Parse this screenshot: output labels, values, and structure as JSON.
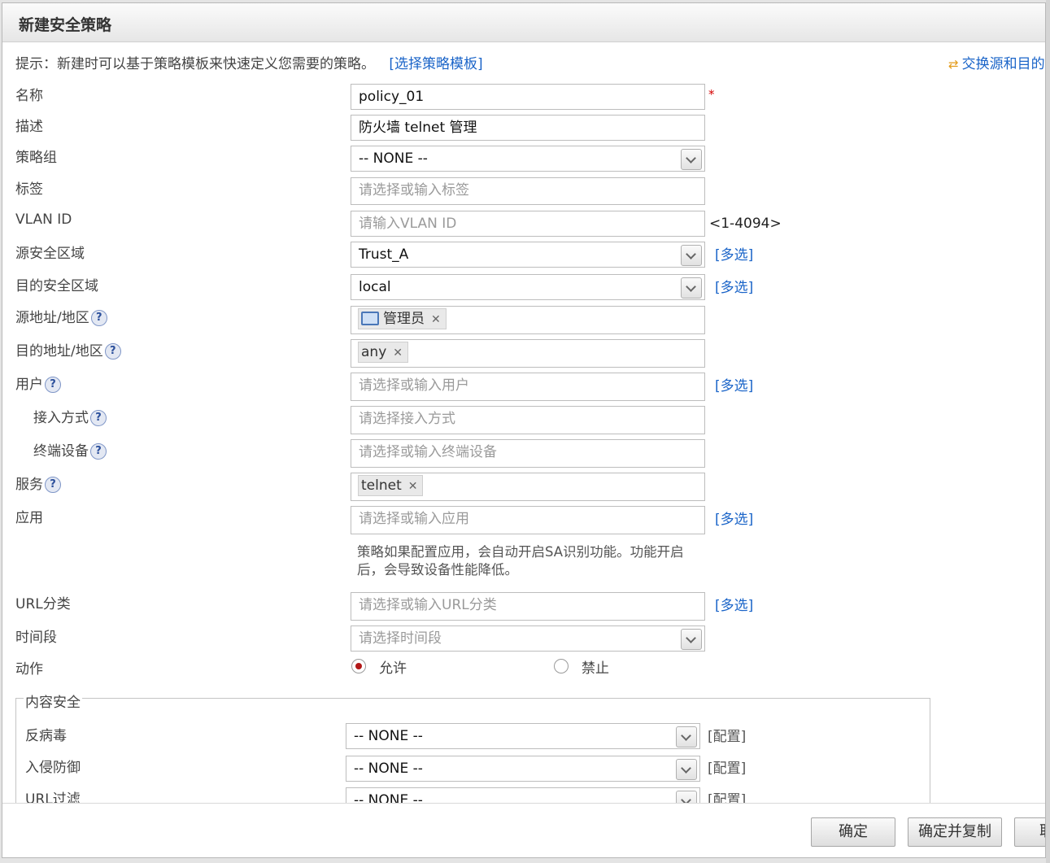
{
  "dialog": {
    "title": "新建安全策略"
  },
  "hint": {
    "text": "提示：新建时可以基于策略模板来快速定义您需要的策略。",
    "template_link": "[选择策略模板]",
    "swap_link": "交换源和目的"
  },
  "form": {
    "name": {
      "label": "名称",
      "value": "policy_01",
      "required_mark": "*"
    },
    "description": {
      "label": "描述",
      "value": "防火墙 telnet 管理"
    },
    "policy_group": {
      "label": "策略组",
      "value": "-- NONE --"
    },
    "tag": {
      "label": "标签",
      "placeholder": "请选择或输入标签"
    },
    "vlan": {
      "label": "VLAN ID",
      "placeholder": "请输入VLAN ID",
      "range": "<1-4094>"
    },
    "src_zone": {
      "label": "源安全区域",
      "value": "Trust_A",
      "multi": "[多选]"
    },
    "dst_zone": {
      "label": "目的安全区域",
      "value": "local",
      "multi": "[多选]"
    },
    "src_addr": {
      "label": "源地址/地区",
      "tag": "管理员"
    },
    "dst_addr": {
      "label": "目的地址/地区",
      "tag": "any"
    },
    "user": {
      "label": "用户",
      "placeholder": "请选择或输入用户",
      "multi": "[多选]"
    },
    "access": {
      "label": "接入方式",
      "placeholder": "请选择接入方式"
    },
    "terminal": {
      "label": "终端设备",
      "placeholder": "请选择或输入终端设备"
    },
    "service": {
      "label": "服务",
      "tag": "telnet"
    },
    "application": {
      "label": "应用",
      "placeholder": "请选择或输入应用",
      "multi": "[多选]",
      "note_line1": "策略如果配置应用，会自动开启SA识别功能。功能开启",
      "note_line2": "后，会导致设备性能降低。"
    },
    "url_category": {
      "label": "URL分类",
      "placeholder": "请选择或输入URL分类",
      "multi": "[多选]"
    },
    "time_range": {
      "label": "时间段",
      "placeholder": "请选择时间段"
    },
    "action": {
      "label": "动作",
      "permit": "允许",
      "deny": "禁止",
      "selected": "permit"
    }
  },
  "content_security": {
    "legend": "内容安全",
    "rows": [
      {
        "label": "反病毒",
        "value": "-- NONE --",
        "config": "[配置]"
      },
      {
        "label": "入侵防御",
        "value": "-- NONE --",
        "config": "[配置]"
      },
      {
        "label": "URL过滤",
        "value": "-- NONE --",
        "config": "[配置]"
      }
    ]
  },
  "footer": {
    "ok": "确定",
    "ok_copy": "确定并复制",
    "cancel": "取消"
  },
  "colors": {
    "link": "#1a64c8",
    "required": "#d40000",
    "radio_selected": "#b21818"
  },
  "icons": {
    "src_addr_tag": "computer-icon",
    "swap": "swap-arrows-icon",
    "help": "help-icon",
    "dropdown": "chevron-down-icon",
    "tag_remove": "close-icon"
  }
}
